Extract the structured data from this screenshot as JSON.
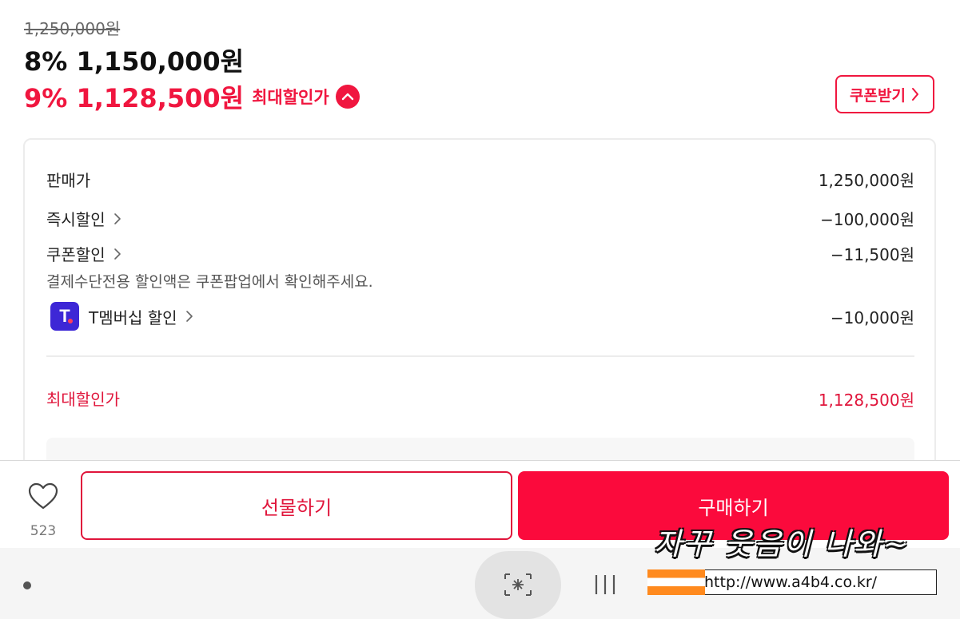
{
  "price": {
    "original": "1,250,000원",
    "sale": "8% 1,150,000원",
    "max_discount": "9% 1,128,500원",
    "max_discount_label": "최대할인가"
  },
  "coupon_button": {
    "label": "쿠폰받기"
  },
  "breakdown": {
    "rows": [
      {
        "label": "판매가",
        "value": "1,250,000원"
      },
      {
        "label": "즉시할인",
        "value": "−100,000원"
      },
      {
        "label": "쿠폰할인",
        "value": "−11,500원"
      },
      {
        "label": "T멤버십 할인",
        "value": "−10,000원"
      }
    ],
    "note": "결제수단전용 할인액은 쿠폰팝업에서 확인해주세요.",
    "total_label": "최대할인가",
    "total_value": "1,128,500원"
  },
  "actions": {
    "like_count": "523",
    "gift_label": "선물하기",
    "buy_label": "구매하기"
  },
  "watermark": {
    "text": "자꾸 웃음이 나와~",
    "url": "http://www.a4b4.co.kr/"
  },
  "colors": {
    "accent": "#f0163f",
    "buy_button": "#fb0a3c",
    "membership_logo": "#3d27d6"
  },
  "icons": [
    "chevron-up-icon",
    "chevron-right-icon",
    "t-membership-logo",
    "heart-icon",
    "home-icon",
    "recent-apps-icon",
    "back-icon"
  ]
}
